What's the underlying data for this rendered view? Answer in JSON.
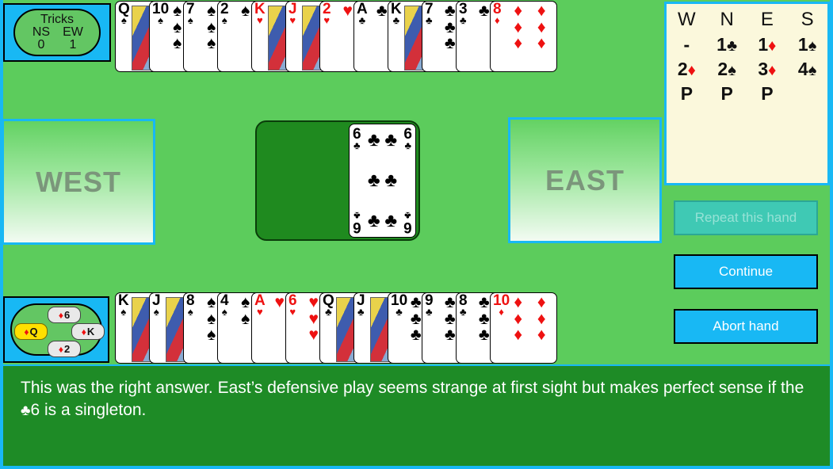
{
  "tricks": {
    "title": "Tricks",
    "ns_label": "NS",
    "ew_label": "EW",
    "ns_value": "0",
    "ew_value": "1"
  },
  "bidding": {
    "headers": [
      "W",
      "N",
      "E",
      "S"
    ],
    "rows": [
      [
        {
          "level": "-",
          "suit": ""
        },
        {
          "level": "1",
          "suit": "♣",
          "color": "black"
        },
        {
          "level": "1",
          "suit": "♦",
          "color": "red"
        },
        {
          "level": "1",
          "suit": "♠",
          "color": "black"
        }
      ],
      [
        {
          "level": "2",
          "suit": "♦",
          "color": "red"
        },
        {
          "level": "2",
          "suit": "♠",
          "color": "black"
        },
        {
          "level": "3",
          "suit": "♦",
          "color": "red"
        },
        {
          "level": "4",
          "suit": "♠",
          "color": "black"
        }
      ],
      [
        {
          "level": "P",
          "suit": ""
        },
        {
          "level": "P",
          "suit": ""
        },
        {
          "level": "P",
          "suit": ""
        },
        {
          "level": "",
          "suit": ""
        }
      ]
    ]
  },
  "buttons": {
    "repeat": "Repeat this hand",
    "continue": "Continue",
    "abort": "Abort hand"
  },
  "placards": {
    "west": "WEST",
    "east": "EAST"
  },
  "north_hand": [
    {
      "rank": "Q",
      "suit": "♠",
      "color": "black",
      "court": true
    },
    {
      "rank": "10",
      "suit": "♠",
      "color": "black",
      "court": false
    },
    {
      "rank": "7",
      "suit": "♠",
      "color": "black",
      "court": false
    },
    {
      "rank": "2",
      "suit": "♠",
      "color": "black",
      "court": false
    },
    {
      "rank": "K",
      "suit": "♥",
      "color": "red",
      "court": true
    },
    {
      "rank": "J",
      "suit": "♥",
      "color": "red",
      "court": true
    },
    {
      "rank": "2",
      "suit": "♥",
      "color": "red",
      "court": false
    },
    {
      "rank": "A",
      "suit": "♣",
      "color": "black",
      "court": false
    },
    {
      "rank": "K",
      "suit": "♣",
      "color": "black",
      "court": true
    },
    {
      "rank": "7",
      "suit": "♣",
      "color": "black",
      "court": false
    },
    {
      "rank": "3",
      "suit": "♣",
      "color": "black",
      "court": false
    },
    {
      "rank": "8",
      "suit": "♦",
      "color": "red",
      "court": false
    }
  ],
  "south_hand": [
    {
      "rank": "K",
      "suit": "♠",
      "color": "black",
      "court": true
    },
    {
      "rank": "J",
      "suit": "♠",
      "color": "black",
      "court": true
    },
    {
      "rank": "8",
      "suit": "♠",
      "color": "black",
      "court": false
    },
    {
      "rank": "4",
      "suit": "♠",
      "color": "black",
      "court": false
    },
    {
      "rank": "A",
      "suit": "♥",
      "color": "red",
      "court": false
    },
    {
      "rank": "6",
      "suit": "♥",
      "color": "red",
      "court": false
    },
    {
      "rank": "Q",
      "suit": "♣",
      "color": "black",
      "court": true
    },
    {
      "rank": "J",
      "suit": "♣",
      "color": "black",
      "court": true
    },
    {
      "rank": "10",
      "suit": "♣",
      "color": "black",
      "court": false
    },
    {
      "rank": "9",
      "suit": "♣",
      "color": "black",
      "court": false
    },
    {
      "rank": "8",
      "suit": "♣",
      "color": "black",
      "court": false
    },
    {
      "rank": "10",
      "suit": "♦",
      "color": "red",
      "court": false
    }
  ],
  "played_card": {
    "rank": "6",
    "suit": "♣",
    "color": "black"
  },
  "previous_trick": [
    {
      "position": "north",
      "suit": "♦",
      "rank": "6",
      "winner": false
    },
    {
      "position": "west",
      "suit": "♦",
      "rank": "Q",
      "winner": true
    },
    {
      "position": "east",
      "suit": "♦",
      "rank": "K",
      "winner": false
    },
    {
      "position": "south",
      "suit": "♦",
      "rank": "2",
      "winner": false
    }
  ],
  "message": {
    "text_before": "This was the right answer. East’s defensive play seems strange at first sight but makes perfect sense if the ",
    "suit_symbol": "♣",
    "text_after": "6 is a singleton."
  },
  "colors": {
    "felt": "#5ccc5c",
    "border": "#18b8f4",
    "message_bg": "#1e8b26",
    "bidding_bg": "#fbf8dc",
    "red_suit": "#ee1111"
  }
}
